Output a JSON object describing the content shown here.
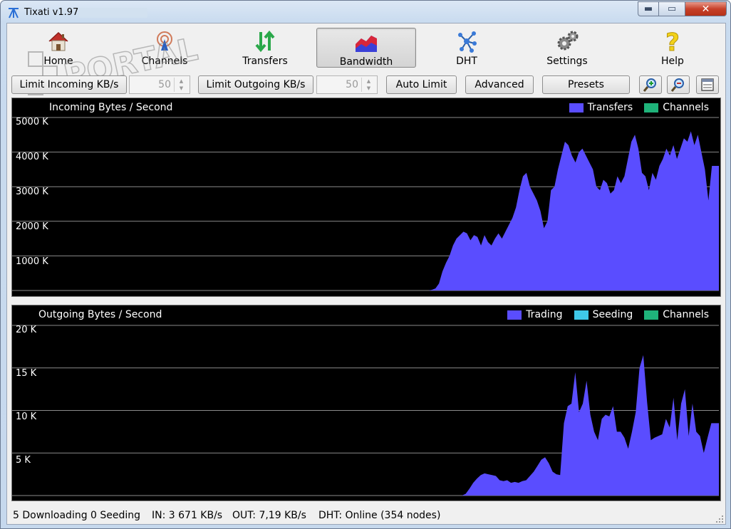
{
  "window": {
    "title": "Tixati v1.97"
  },
  "toolbar": {
    "items": [
      {
        "label": "Home",
        "icon": "home-icon"
      },
      {
        "label": "Channels",
        "icon": "channels-icon"
      },
      {
        "label": "Transfers",
        "icon": "transfers-icon"
      },
      {
        "label": "Bandwidth",
        "icon": "bandwidth-icon",
        "active": true
      },
      {
        "label": "DHT",
        "icon": "dht-icon"
      },
      {
        "label": "Settings",
        "icon": "gear-icon"
      },
      {
        "label": "Help",
        "icon": "help-icon"
      }
    ]
  },
  "limits": {
    "incoming_label": "Limit Incoming KB/s",
    "incoming_value": "50",
    "outgoing_label": "Limit Outgoing KB/s",
    "outgoing_value": "50",
    "auto_limit": "Auto Limit",
    "advanced": "Advanced",
    "presets": "Presets"
  },
  "colors": {
    "transfers": "#5a4dff",
    "channels": "#1fb37a",
    "seeding": "#3fc8e8",
    "gridline": "#8a8a8a"
  },
  "incoming_graph": {
    "title": "Incoming Bytes / Second",
    "legend": [
      "Transfers",
      "Channels"
    ],
    "y_ticks": [
      "5000 K",
      "4000 K",
      "3000 K",
      "2000 K",
      "1000 K"
    ]
  },
  "outgoing_graph": {
    "title": "Outgoing Bytes / Second",
    "legend": [
      "Trading",
      "Seeding",
      "Channels"
    ],
    "y_ticks": [
      "20 K",
      "15 K",
      "10 K",
      "5 K"
    ]
  },
  "chart_data": [
    {
      "type": "area",
      "title": "Incoming Bytes / Second",
      "ylim": [
        0,
        5000
      ],
      "yunit": "K",
      "series": [
        {
          "name": "Transfers",
          "values": [
            0,
            0,
            0,
            0,
            0,
            0,
            0,
            0,
            0,
            0,
            0,
            0,
            0,
            0,
            0,
            0,
            0,
            0,
            0,
            0,
            0,
            0,
            0,
            0,
            0,
            0,
            0,
            0,
            0,
            0,
            0,
            0,
            0,
            0,
            0,
            0,
            0,
            0,
            0,
            0,
            0,
            0,
            0,
            0,
            0,
            0,
            0,
            0,
            0,
            0,
            0,
            0,
            0,
            0,
            0,
            0,
            0,
            0,
            0,
            0,
            0,
            0,
            0,
            0,
            0,
            0,
            0,
            0,
            0,
            0,
            0,
            0,
            0,
            0,
            0,
            0,
            0,
            0,
            0,
            0,
            0,
            0,
            0,
            0,
            0,
            0,
            0,
            0,
            0,
            0,
            0,
            0,
            0,
            0,
            0,
            0,
            0,
            0,
            0,
            0,
            0,
            0,
            0,
            0,
            0,
            0,
            0,
            0,
            0,
            0,
            0,
            0,
            0,
            0,
            0,
            0,
            0,
            0,
            0,
            0,
            20,
            60,
            200,
            550,
            800,
            1000,
            1300,
            1500,
            1600,
            1700,
            1650,
            1450,
            1600,
            1550,
            1300,
            1600,
            1400,
            1300,
            1500,
            1650,
            1500,
            1700,
            1900,
            2100,
            2400,
            2900,
            3300,
            3400,
            3000,
            2800,
            2600,
            2300,
            1800,
            2000,
            2900,
            3000,
            3500,
            3900,
            4300,
            4200,
            3900,
            3700,
            4000,
            4100,
            3900,
            3700,
            3500,
            3000,
            2900,
            3200,
            3100,
            2800,
            2900,
            3300,
            3100,
            3300,
            3800,
            4300,
            4500,
            4100,
            3400,
            3300,
            2900,
            3400,
            3200,
            3600,
            3800,
            4100,
            3900,
            4200,
            3800,
            4100,
            4400,
            4300,
            4600,
            4200,
            4500,
            4000,
            3500,
            2600,
            3600,
            3600,
            3600
          ]
        }
      ]
    },
    {
      "type": "area",
      "title": "Outgoing Bytes / Second",
      "ylim": [
        0,
        20
      ],
      "yunit": "K",
      "series": [
        {
          "name": "Trading",
          "values": [
            0,
            0,
            0,
            0,
            0,
            0,
            0,
            0,
            0,
            0,
            0,
            0,
            0,
            0,
            0,
            0,
            0,
            0,
            0,
            0,
            0,
            0,
            0,
            0,
            0,
            0,
            0,
            0,
            0,
            0,
            0,
            0,
            0,
            0,
            0,
            0,
            0,
            0,
            0,
            0,
            0,
            0,
            0,
            0,
            0,
            0,
            0,
            0,
            0,
            0,
            0,
            0,
            0,
            0,
            0,
            0,
            0,
            0,
            0,
            0,
            0,
            0,
            0,
            0,
            0,
            0,
            0,
            0,
            0,
            0,
            0,
            0,
            0,
            0,
            0,
            0,
            0,
            0,
            0,
            0,
            0,
            0,
            0,
            0,
            0,
            0,
            0,
            0,
            0,
            0,
            0,
            0,
            0,
            0,
            0,
            0,
            0,
            0,
            0,
            0,
            0,
            0,
            0,
            0,
            0,
            0,
            0,
            0,
            0,
            0,
            0,
            0,
            0,
            0,
            0,
            0,
            0,
            0,
            0,
            0,
            0.2,
            0.8,
            1.5,
            2,
            2.4,
            2.6,
            2.5,
            2.4,
            2.3,
            1.8,
            1.7,
            1.8,
            1.5,
            1.6,
            1.5,
            1.7,
            1.8,
            2.3,
            2.8,
            3.5,
            4.2,
            4.5,
            3.8,
            2.8,
            2.5,
            2.4,
            8.5,
            10.5,
            10.8,
            14.5,
            9.8,
            10.8,
            13.5,
            9.5,
            7.5,
            6.5,
            9.0,
            9.5,
            9.3,
            10.5,
            7.5,
            7.5,
            6.8,
            5.5,
            7.5,
            9.8,
            15.0,
            16.5,
            11.0,
            6.5,
            6.8,
            7.0,
            7.2,
            9.0,
            8.0,
            11.5,
            6.5,
            10.8,
            12.5,
            7.0,
            10.8,
            7.5,
            7.0,
            5.0,
            6.8,
            8.5,
            8.5,
            8.5
          ]
        }
      ]
    }
  ],
  "status": {
    "downloading": "5 Downloading",
    "seeding": "0 Seeding",
    "in": "IN: 3 671 KB/s",
    "out": "OUT: 7,19 KB/s",
    "dht": "DHT: Online (354 nodes)"
  }
}
